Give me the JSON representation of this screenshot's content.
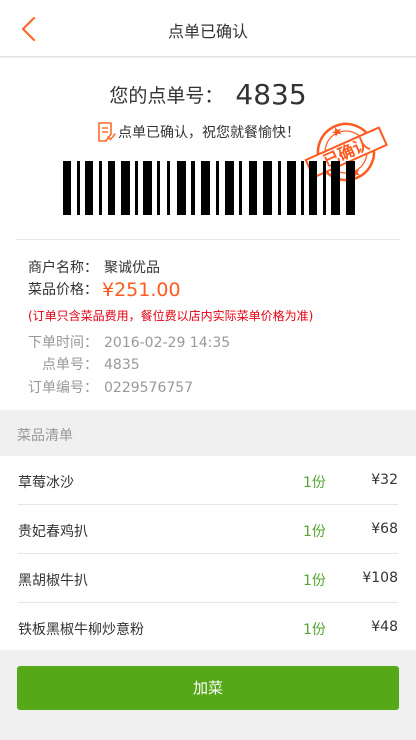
{
  "header": {
    "title": "点单已确认"
  },
  "ticket": {
    "order_no_label": "您的点单号：",
    "order_no": "4835",
    "confirm_text": "点单已确认，祝您就餐愉快！",
    "stamp_text": "已确认",
    "stamp_color": "#ff5a1f"
  },
  "info": {
    "merchant_label": "商户名称：",
    "merchant": "聚诚优品",
    "price_label": "菜品价格：",
    "price": "¥251.00",
    "price_note": "(订单只含菜品费用，餐位费以店内实际菜单价格为准)",
    "time_label": "下单时间：",
    "time": "2016-02-29 14:35",
    "order_label": "点单号：",
    "order": "4835",
    "serial_label": "订单编号：",
    "serial": "0229576757"
  },
  "menu": {
    "title": "菜品清单",
    "items": [
      {
        "name": "草莓冰沙",
        "qty": "1份",
        "amount": "¥32"
      },
      {
        "name": "贵妃春鸡扒",
        "qty": "1份",
        "amount": "¥68"
      },
      {
        "name": "黑胡椒牛扒",
        "qty": "1份",
        "amount": "¥108"
      },
      {
        "name": "铁板黑椒牛柳炒意粉",
        "qty": "1份",
        "amount": "¥48"
      }
    ]
  },
  "actions": {
    "add_label": "加菜"
  },
  "colors": {
    "accent": "#ff5a1f",
    "primary_button": "#55a818",
    "quantity": "#55a532",
    "note": "#e60012"
  }
}
